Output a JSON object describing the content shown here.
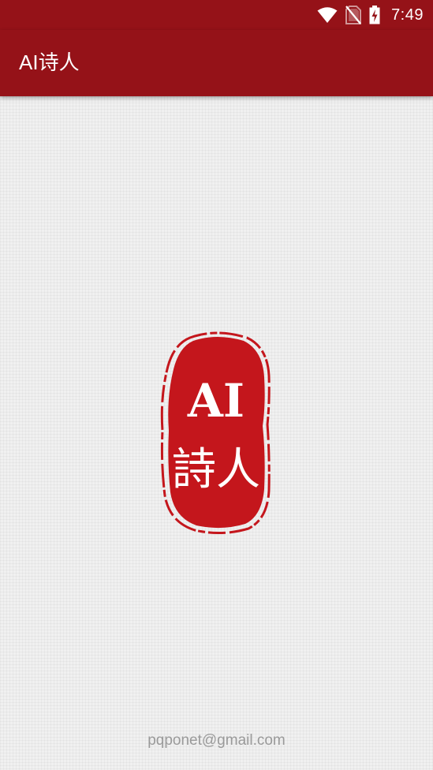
{
  "status_bar": {
    "time": "7:49",
    "icons": [
      "wifi-icon",
      "no-sim-icon",
      "battery-charging-icon"
    ]
  },
  "app_bar": {
    "title": "AI诗人"
  },
  "splash": {
    "logo": "ai-poet-seal",
    "seal_text_top": "AI",
    "seal_text_bottom": "詩人",
    "seal_color": "#c4161c"
  },
  "footer": {
    "email": "pqponet@gmail.com"
  },
  "colors": {
    "primary": "#951218",
    "background": "#f0f0f0",
    "footer_text": "#9a9a9a"
  }
}
